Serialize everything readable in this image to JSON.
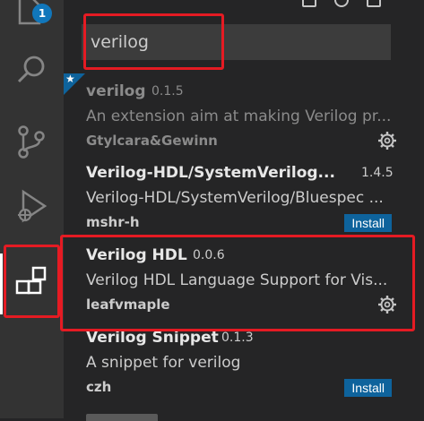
{
  "activity_bar": {
    "items": [
      {
        "name": "explorer",
        "badge": "1"
      },
      {
        "name": "search"
      },
      {
        "name": "source-control"
      },
      {
        "name": "run-debug"
      },
      {
        "name": "extensions",
        "active": true
      }
    ]
  },
  "search": {
    "value": "verilog"
  },
  "extensions": [
    {
      "name": "verilog",
      "version": "0.1.5",
      "description": "An extension aim at making Verilog pr...",
      "publisher": "Gtylcara&Gewinn",
      "action": "gear",
      "disabled": true,
      "recommended": true
    },
    {
      "name": "Verilog-HDL/SystemVerilog...",
      "version": "1.4.5",
      "description": "Verilog-HDL/SystemVerilog/Bluespec ...",
      "publisher": "mshr-h",
      "action": "install",
      "install_label": "Install"
    },
    {
      "name": "Verilog HDL",
      "version": "0.0.6",
      "description": "Verilog HDL Language Support for Vis...",
      "publisher": "leafvmaple",
      "action": "gear"
    },
    {
      "name": "Verilog Snippet",
      "version": "0.1.3",
      "description": "A snippet for verilog",
      "publisher": "czh",
      "action": "install",
      "install_label": "Install"
    }
  ],
  "colors": {
    "activity_bg": "#333333",
    "panel_bg": "#252526",
    "accent": "#0e639c",
    "annotation": "#e51b23"
  }
}
